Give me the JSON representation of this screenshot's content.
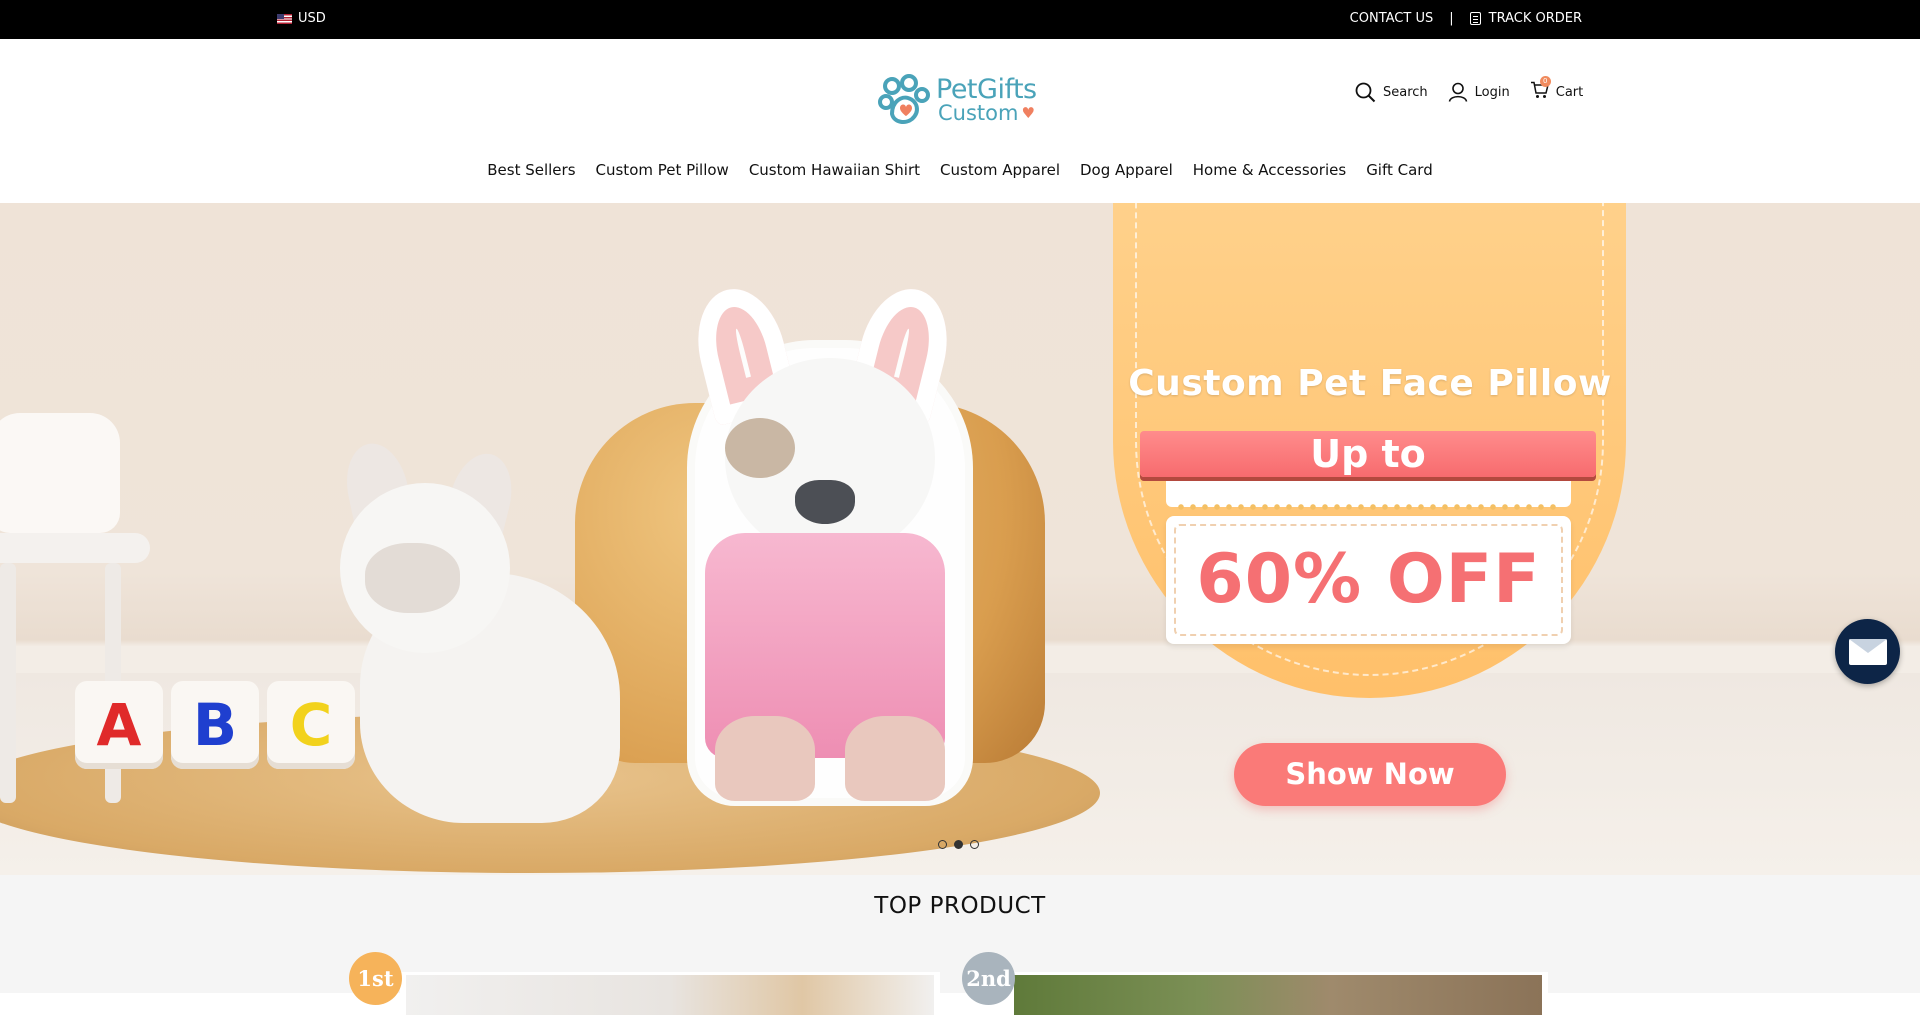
{
  "topbar": {
    "currency": "USD",
    "contact_label": "CONTACT US",
    "separator": "|",
    "track_label": "TRACK ORDER"
  },
  "header": {
    "logo_line1": "PetGifts",
    "logo_line2": "Custom",
    "search_label": "Search",
    "login_label": "Login",
    "cart_label": "Cart",
    "cart_count": "0"
  },
  "nav": {
    "items": [
      {
        "label": "Best Sellers"
      },
      {
        "label": "Custom Pet Pillow"
      },
      {
        "label": "Custom Hawaiian Shirt"
      },
      {
        "label": "Custom Apparel"
      },
      {
        "label": "Dog Apparel"
      },
      {
        "label": "Home & Accessories"
      },
      {
        "label": "Gift Card"
      }
    ]
  },
  "hero": {
    "title": "Custom Pet Face Pillow",
    "ribbon": "Up to",
    "offer": "60% OFF",
    "cta": "Show Now",
    "blocks": [
      "A",
      "B",
      "C"
    ],
    "slide_count": 3,
    "active_slide": 2
  },
  "section": {
    "title": "TOP PRODUCT",
    "ranks": [
      "1st",
      "2nd"
    ]
  },
  "colors": {
    "brand_teal": "#4aa3b9",
    "accent_coral": "#fa7a78",
    "banner_orange": "#ffc06a",
    "offer_red": "#f57073",
    "chat_navy": "#0d2547",
    "rank_gold": "#f6b35a",
    "rank_silver": "#a9b4bd"
  },
  "icons": {
    "flag": "us-flag-icon",
    "track": "clipboard-icon",
    "search": "search-icon",
    "login": "user-icon",
    "cart": "cart-icon",
    "chat": "mail-icon"
  }
}
